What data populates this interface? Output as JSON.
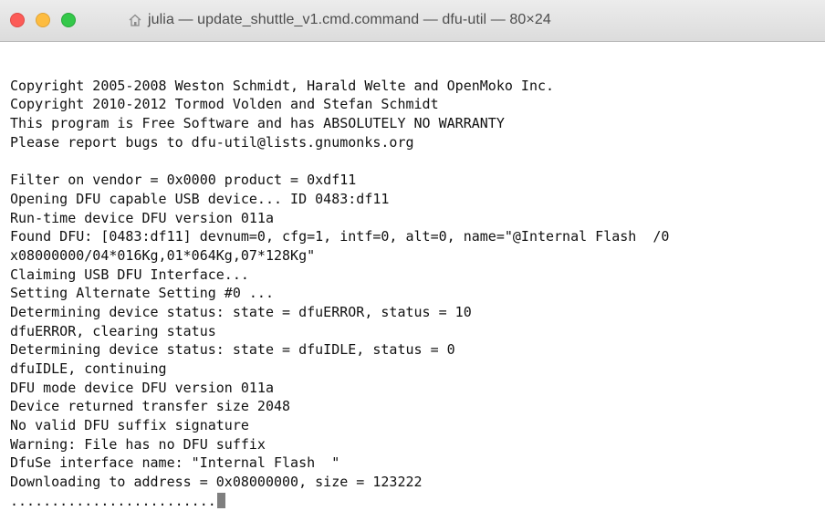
{
  "window": {
    "title": "julia — update_shuttle_v1.cmd.command — dfu-util — 80×24",
    "title_icon": "home-icon"
  },
  "terminal": {
    "lines": [
      "",
      "Copyright 2005-2008 Weston Schmidt, Harald Welte and OpenMoko Inc.",
      "Copyright 2010-2012 Tormod Volden and Stefan Schmidt",
      "This program is Free Software and has ABSOLUTELY NO WARRANTY",
      "Please report bugs to dfu-util@lists.gnumonks.org",
      "",
      "Filter on vendor = 0x0000 product = 0xdf11",
      "Opening DFU capable USB device... ID 0483:df11",
      "Run-time device DFU version 011a",
      "Found DFU: [0483:df11] devnum=0, cfg=1, intf=0, alt=0, name=\"@Internal Flash  /0",
      "x08000000/04*016Kg,01*064Kg,07*128Kg\"",
      "Claiming USB DFU Interface...",
      "Setting Alternate Setting #0 ...",
      "Determining device status: state = dfuERROR, status = 10",
      "dfuERROR, clearing status",
      "Determining device status: state = dfuIDLE, status = 0",
      "dfuIDLE, continuing",
      "DFU mode device DFU version 011a",
      "Device returned transfer size 2048",
      "No valid DFU suffix signature",
      "Warning: File has no DFU suffix",
      "DfuSe interface name: \"Internal Flash  \"",
      "Downloading to address = 0x08000000, size = 123222",
      "........................."
    ]
  },
  "colors": {
    "close": "#fc5b57",
    "minimize": "#fdbc40",
    "maximize": "#34c84a",
    "text": "#111111",
    "background": "#ffffff"
  }
}
